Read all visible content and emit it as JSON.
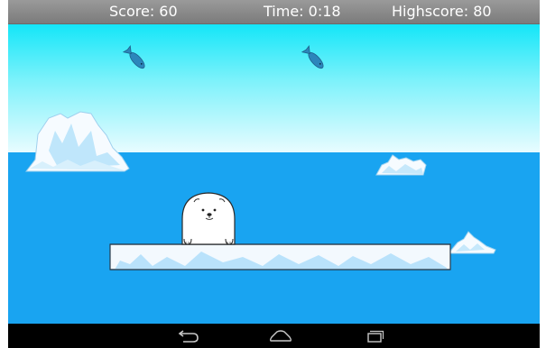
{
  "hud": {
    "score_text": "Score: 60",
    "time_text": "Time: 0:18",
    "highscore_text": "Highscore: 80"
  },
  "game": {
    "sprites": {
      "player": "polar-bear",
      "falling_items": [
        "fish",
        "fish"
      ],
      "platform": "ice-floe",
      "background": [
        "iceberg",
        "iceberg",
        "iceberg"
      ]
    },
    "colors": {
      "sky_top": "#16e8f8",
      "sky_bottom": "#e6fbff",
      "sea": "#1aa3f0",
      "fish": "#2c86bb"
    }
  },
  "navbar": {
    "buttons": [
      "back",
      "home",
      "recent-apps"
    ]
  }
}
